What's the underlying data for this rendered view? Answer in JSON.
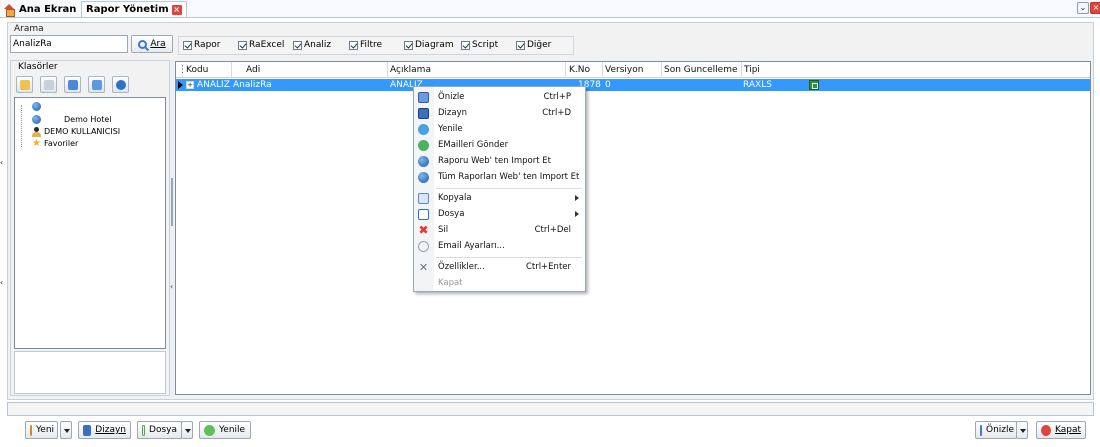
{
  "tabs": [
    {
      "label": "Ana Ekran"
    },
    {
      "label": "Rapor Yönetim"
    }
  ],
  "search": {
    "group_label": "Arama",
    "value": "AnalizRa",
    "button_label": "Ara"
  },
  "filters": [
    {
      "label": "Rapor",
      "checked": true
    },
    {
      "label": "RaExcel",
      "checked": true
    },
    {
      "label": "Analiz",
      "checked": true
    },
    {
      "label": "Filtre",
      "checked": true
    },
    {
      "label": "Diagram",
      "checked": true
    },
    {
      "label": "Script",
      "checked": true
    },
    {
      "label": "Diğer",
      "checked": true
    }
  ],
  "folders": {
    "label": "Klasörler",
    "tree": [
      {
        "label": "Demo Hotel"
      },
      {
        "label": "DEMO KULLANICISI"
      },
      {
        "label": "Favoriler"
      }
    ]
  },
  "grid": {
    "columns": [
      "Kodu",
      "Adi",
      "Açıklama",
      "K.No",
      "Versiyon",
      "Son Guncelleme",
      "Tipi"
    ],
    "rows": [
      {
        "kodu": "ANALIZ",
        "adi": "AnalizRa",
        "aciklama": "ANALIZ",
        "kno": "1878",
        "versiyon": "0",
        "son_guncelleme": "",
        "tipi": "RAXLS"
      }
    ]
  },
  "context_menu": {
    "items": [
      {
        "label": "Önizle",
        "shortcut": "Ctrl+P",
        "icon": "preview-icon"
      },
      {
        "label": "Dizayn",
        "shortcut": "Ctrl+D",
        "icon": "design-icon"
      },
      {
        "label": "Yenile",
        "shortcut": "",
        "icon": "refresh-icon"
      },
      {
        "label": "EMailleri Gönder",
        "shortcut": "",
        "icon": "email-icon"
      },
      {
        "label": "Raporu Web' ten Import Et",
        "shortcut": "",
        "icon": "web-import-icon"
      },
      {
        "label": "Tüm Raporları Web' ten Import Et",
        "shortcut": "",
        "icon": "web-import-all-icon"
      },
      {
        "label": "Kopyala",
        "shortcut": "",
        "icon": "copy-icon"
      },
      {
        "label": "Dosya",
        "shortcut": "",
        "icon": "file-icon"
      },
      {
        "label": "Sil",
        "shortcut": "Ctrl+Del",
        "icon": "delete-icon"
      },
      {
        "label": "Email Ayarları...",
        "shortcut": "",
        "icon": "email-settings-icon"
      },
      {
        "label": "Özellikler...",
        "shortcut": "Ctrl+Enter",
        "icon": "properties-icon"
      },
      {
        "label": "Kapat",
        "shortcut": "",
        "icon": ""
      }
    ]
  },
  "toolbar": {
    "yeni": "Yeni",
    "dizayn": "Dizayn",
    "dosya": "Dosya",
    "yenile": "Yenile",
    "onizle": "Önizle",
    "kapat": "Kapat"
  },
  "colors": {
    "selection": "#3399ff",
    "close_red": "#e0443a"
  }
}
